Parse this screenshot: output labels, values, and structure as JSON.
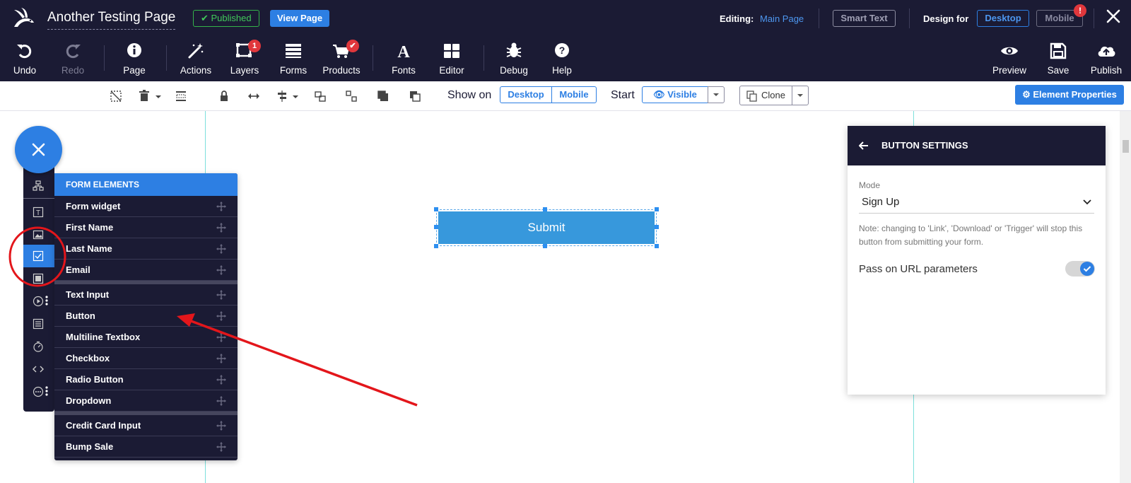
{
  "header": {
    "page_title": "Another Testing Page",
    "published_label": "Published",
    "view_page_label": "View Page",
    "editing_label": "Editing:",
    "editing_value": "Main Page",
    "smart_text_label": "Smart Text",
    "design_for_label": "Design for",
    "desktop_label": "Desktop",
    "mobile_label": "Mobile",
    "mobile_alert": "!"
  },
  "toolbar": {
    "undo": "Undo",
    "redo": "Redo",
    "page": "Page",
    "actions": "Actions",
    "layers": "Layers",
    "layers_count": "1",
    "forms": "Forms",
    "products": "Products",
    "fonts": "Fonts",
    "editor": "Editor",
    "debug": "Debug",
    "help": "Help",
    "preview": "Preview",
    "save": "Save",
    "publish": "Publish"
  },
  "subbar": {
    "show_on_label": "Show on",
    "show_desktop": "Desktop",
    "show_mobile": "Mobile",
    "start_label": "Start",
    "visible_label": "Visible",
    "clone_label": "Clone",
    "element_properties_label": "Element Properties"
  },
  "canvas": {
    "submit_label": "Submit"
  },
  "form_panel": {
    "title": "FORM ELEMENTS",
    "items": [
      "Form widget",
      "First Name",
      "Last Name",
      "Email",
      "Text Input",
      "Button",
      "Multiline Textbox",
      "Checkbox",
      "Radio Button",
      "Dropdown",
      "Credit Card Input",
      "Bump Sale"
    ]
  },
  "settings": {
    "title": "BUTTON SETTINGS",
    "mode_label": "Mode",
    "mode_value": "Sign Up",
    "mode_note": "Note: changing to 'Link', 'Download' or 'Trigger' will stop this button from submitting your form.",
    "pass_url_label": "Pass on URL parameters",
    "pass_url_enabled": true
  },
  "colors": {
    "navy": "#1b1b34",
    "accent": "#2d7fe3",
    "published_green": "#41c95a",
    "alert_red": "#e0373c",
    "annotation_red": "#e3161b"
  }
}
